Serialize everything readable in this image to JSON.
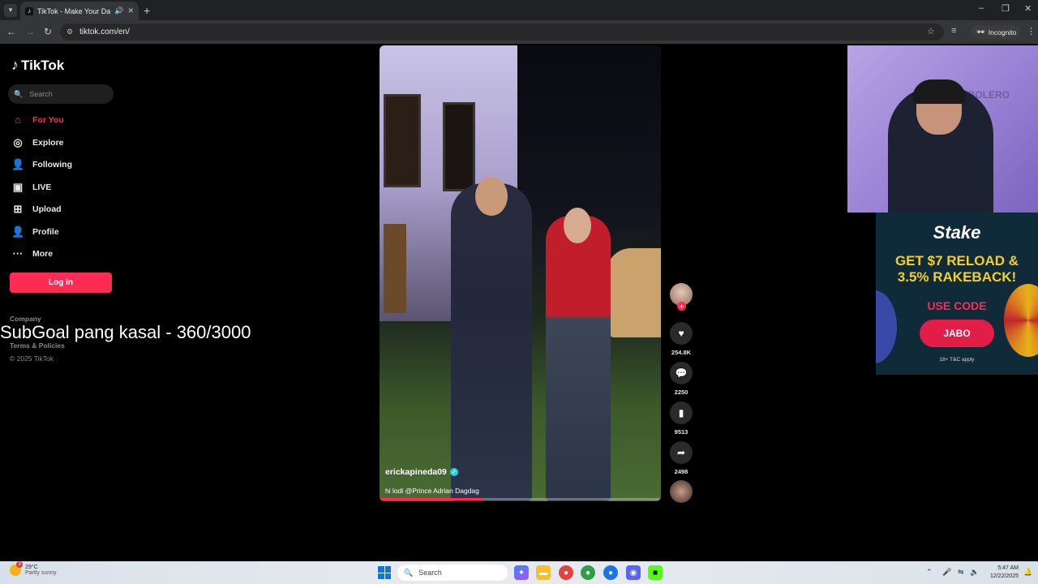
{
  "browser": {
    "tab_title": "TikTok - Make Your Day",
    "new_tab": "+",
    "url": "tiktok.com/en/",
    "incognito_label": "Incognito",
    "window_controls": [
      "–",
      "❐",
      "✕"
    ]
  },
  "sidebar": {
    "logo_text": "TikTok",
    "search_placeholder": "Search",
    "nav": [
      {
        "label": "For You",
        "icon": "home-icon",
        "active": true
      },
      {
        "label": "Explore",
        "icon": "compass-icon"
      },
      {
        "label": "Following",
        "icon": "following-icon"
      },
      {
        "label": "LIVE",
        "icon": "live-icon"
      },
      {
        "label": "Upload",
        "icon": "upload-icon"
      },
      {
        "label": "Profile",
        "icon": "profile-icon"
      },
      {
        "label": "More",
        "icon": "more-icon"
      }
    ],
    "login_label": "Log in",
    "footer": {
      "company": "Company",
      "terms": "Terms & Policies",
      "copyright": "© 2025 TikTok"
    }
  },
  "stream_overlay": {
    "subgoal_text": "SubGoal pang kasal - 360/3000"
  },
  "video": {
    "username": "erickapineda09",
    "caption": "hi lodi @Prince Adrian Dagdag",
    "progress": 0.37
  },
  "actions": {
    "likes": "254.8K",
    "comments": "2250",
    "saves": "9513",
    "shares": "2498",
    "follow_plus": "+"
  },
  "ad": {
    "brand": "Stake",
    "headline_line1": "GET $7 RELOAD &",
    "headline_line2": "3.5% RAKEBACK!",
    "use_code": "USE CODE",
    "code": "JABO",
    "disclaimer": "18+ T&C apply"
  },
  "webcam": {
    "watermark": "ABOLERO"
  },
  "taskbar": {
    "weather_temp": "29°C",
    "weather_desc": "Partly sunny",
    "weather_badge": "3",
    "search_placeholder": "Search",
    "time": "5:47 AM",
    "date": "12/22/2025"
  },
  "colors": {
    "accent": "#fe2c55",
    "background": "#000000",
    "verified": "#20d5ec"
  }
}
